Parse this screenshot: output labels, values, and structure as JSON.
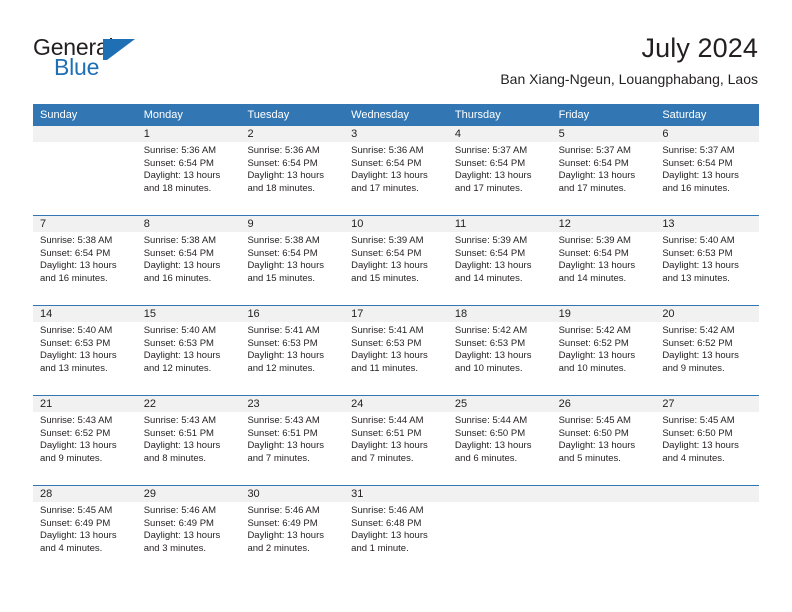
{
  "brand": {
    "name_top": "General",
    "name_bottom": "Blue",
    "accent_color": "#1f6fb5"
  },
  "header": {
    "title": "July 2024",
    "subtitle": "Ban Xiang-Ngeun, Louangphabang, Laos"
  },
  "calendar": {
    "header_bg": "#3277b3",
    "datestrip_bg": "#f1f1f1",
    "separator_color": "#3277b3",
    "weekdays": [
      "Sunday",
      "Monday",
      "Tuesday",
      "Wednesday",
      "Thursday",
      "Friday",
      "Saturday"
    ],
    "weeks": [
      {
        "days": [
          {
            "num": "",
            "lines": []
          },
          {
            "num": "1",
            "lines": [
              "Sunrise: 5:36 AM",
              "Sunset: 6:54 PM",
              "Daylight: 13 hours",
              "and 18 minutes."
            ]
          },
          {
            "num": "2",
            "lines": [
              "Sunrise: 5:36 AM",
              "Sunset: 6:54 PM",
              "Daylight: 13 hours",
              "and 18 minutes."
            ]
          },
          {
            "num": "3",
            "lines": [
              "Sunrise: 5:36 AM",
              "Sunset: 6:54 PM",
              "Daylight: 13 hours",
              "and 17 minutes."
            ]
          },
          {
            "num": "4",
            "lines": [
              "Sunrise: 5:37 AM",
              "Sunset: 6:54 PM",
              "Daylight: 13 hours",
              "and 17 minutes."
            ]
          },
          {
            "num": "5",
            "lines": [
              "Sunrise: 5:37 AM",
              "Sunset: 6:54 PM",
              "Daylight: 13 hours",
              "and 17 minutes."
            ]
          },
          {
            "num": "6",
            "lines": [
              "Sunrise: 5:37 AM",
              "Sunset: 6:54 PM",
              "Daylight: 13 hours",
              "and 16 minutes."
            ]
          }
        ]
      },
      {
        "days": [
          {
            "num": "7",
            "lines": [
              "Sunrise: 5:38 AM",
              "Sunset: 6:54 PM",
              "Daylight: 13 hours",
              "and 16 minutes."
            ]
          },
          {
            "num": "8",
            "lines": [
              "Sunrise: 5:38 AM",
              "Sunset: 6:54 PM",
              "Daylight: 13 hours",
              "and 16 minutes."
            ]
          },
          {
            "num": "9",
            "lines": [
              "Sunrise: 5:38 AM",
              "Sunset: 6:54 PM",
              "Daylight: 13 hours",
              "and 15 minutes."
            ]
          },
          {
            "num": "10",
            "lines": [
              "Sunrise: 5:39 AM",
              "Sunset: 6:54 PM",
              "Daylight: 13 hours",
              "and 15 minutes."
            ]
          },
          {
            "num": "11",
            "lines": [
              "Sunrise: 5:39 AM",
              "Sunset: 6:54 PM",
              "Daylight: 13 hours",
              "and 14 minutes."
            ]
          },
          {
            "num": "12",
            "lines": [
              "Sunrise: 5:39 AM",
              "Sunset: 6:54 PM",
              "Daylight: 13 hours",
              "and 14 minutes."
            ]
          },
          {
            "num": "13",
            "lines": [
              "Sunrise: 5:40 AM",
              "Sunset: 6:53 PM",
              "Daylight: 13 hours",
              "and 13 minutes."
            ]
          }
        ]
      },
      {
        "days": [
          {
            "num": "14",
            "lines": [
              "Sunrise: 5:40 AM",
              "Sunset: 6:53 PM",
              "Daylight: 13 hours",
              "and 13 minutes."
            ]
          },
          {
            "num": "15",
            "lines": [
              "Sunrise: 5:40 AM",
              "Sunset: 6:53 PM",
              "Daylight: 13 hours",
              "and 12 minutes."
            ]
          },
          {
            "num": "16",
            "lines": [
              "Sunrise: 5:41 AM",
              "Sunset: 6:53 PM",
              "Daylight: 13 hours",
              "and 12 minutes."
            ]
          },
          {
            "num": "17",
            "lines": [
              "Sunrise: 5:41 AM",
              "Sunset: 6:53 PM",
              "Daylight: 13 hours",
              "and 11 minutes."
            ]
          },
          {
            "num": "18",
            "lines": [
              "Sunrise: 5:42 AM",
              "Sunset: 6:53 PM",
              "Daylight: 13 hours",
              "and 10 minutes."
            ]
          },
          {
            "num": "19",
            "lines": [
              "Sunrise: 5:42 AM",
              "Sunset: 6:52 PM",
              "Daylight: 13 hours",
              "and 10 minutes."
            ]
          },
          {
            "num": "20",
            "lines": [
              "Sunrise: 5:42 AM",
              "Sunset: 6:52 PM",
              "Daylight: 13 hours",
              "and 9 minutes."
            ]
          }
        ]
      },
      {
        "days": [
          {
            "num": "21",
            "lines": [
              "Sunrise: 5:43 AM",
              "Sunset: 6:52 PM",
              "Daylight: 13 hours",
              "and 9 minutes."
            ]
          },
          {
            "num": "22",
            "lines": [
              "Sunrise: 5:43 AM",
              "Sunset: 6:51 PM",
              "Daylight: 13 hours",
              "and 8 minutes."
            ]
          },
          {
            "num": "23",
            "lines": [
              "Sunrise: 5:43 AM",
              "Sunset: 6:51 PM",
              "Daylight: 13 hours",
              "and 7 minutes."
            ]
          },
          {
            "num": "24",
            "lines": [
              "Sunrise: 5:44 AM",
              "Sunset: 6:51 PM",
              "Daylight: 13 hours",
              "and 7 minutes."
            ]
          },
          {
            "num": "25",
            "lines": [
              "Sunrise: 5:44 AM",
              "Sunset: 6:50 PM",
              "Daylight: 13 hours",
              "and 6 minutes."
            ]
          },
          {
            "num": "26",
            "lines": [
              "Sunrise: 5:45 AM",
              "Sunset: 6:50 PM",
              "Daylight: 13 hours",
              "and 5 minutes."
            ]
          },
          {
            "num": "27",
            "lines": [
              "Sunrise: 5:45 AM",
              "Sunset: 6:50 PM",
              "Daylight: 13 hours",
              "and 4 minutes."
            ]
          }
        ]
      },
      {
        "days": [
          {
            "num": "28",
            "lines": [
              "Sunrise: 5:45 AM",
              "Sunset: 6:49 PM",
              "Daylight: 13 hours",
              "and 4 minutes."
            ]
          },
          {
            "num": "29",
            "lines": [
              "Sunrise: 5:46 AM",
              "Sunset: 6:49 PM",
              "Daylight: 13 hours",
              "and 3 minutes."
            ]
          },
          {
            "num": "30",
            "lines": [
              "Sunrise: 5:46 AM",
              "Sunset: 6:49 PM",
              "Daylight: 13 hours",
              "and 2 minutes."
            ]
          },
          {
            "num": "31",
            "lines": [
              "Sunrise: 5:46 AM",
              "Sunset: 6:48 PM",
              "Daylight: 13 hours",
              "and 1 minute."
            ]
          },
          {
            "num": "",
            "lines": []
          },
          {
            "num": "",
            "lines": []
          },
          {
            "num": "",
            "lines": []
          }
        ]
      }
    ]
  }
}
